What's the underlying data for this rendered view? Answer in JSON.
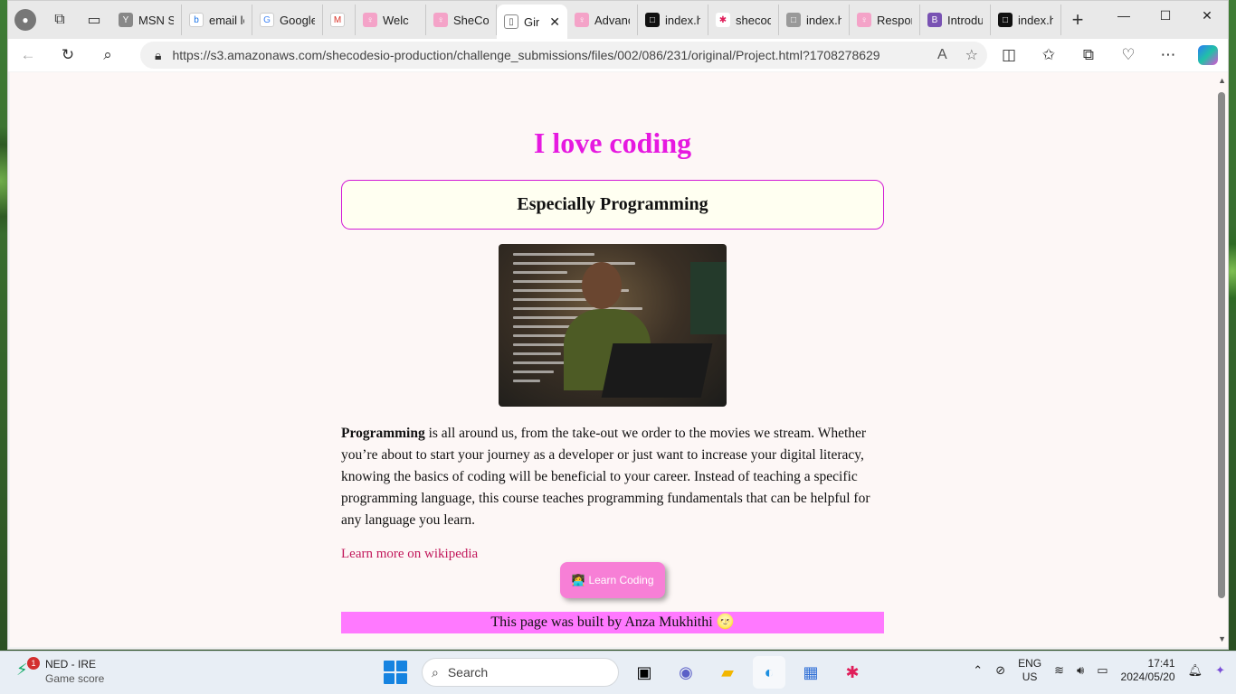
{
  "browser": {
    "tabs": [
      {
        "label": "",
        "icon": "workspaces-icon"
      },
      {
        "label": "MSN Sc",
        "icon": "msn-icon"
      },
      {
        "label": "email lo",
        "icon": "bing-icon"
      },
      {
        "label": "Google",
        "icon": "google-icon"
      },
      {
        "label": "",
        "icon": "gmail-icon"
      },
      {
        "label": "Welc",
        "icon": "shecodes-icon"
      },
      {
        "label": "SheCod",
        "icon": "shecodes-icon"
      },
      {
        "label": "Gir",
        "icon": "document-icon",
        "active": true
      },
      {
        "label": "Advance",
        "icon": "shecodes-icon"
      },
      {
        "label": "index.ht",
        "icon": "codesandbox-icon"
      },
      {
        "label": "shecode",
        "icon": "slack-icon"
      },
      {
        "label": "index.ht",
        "icon": "page-icon"
      },
      {
        "label": "Respons",
        "icon": "shecodes-icon"
      },
      {
        "label": "Introduc",
        "icon": "bootstrap-icon"
      },
      {
        "label": "index.ht",
        "icon": "codesandbox-icon"
      }
    ],
    "url": "https://s3.amazonaws.com/shecodesio-production/challenge_submissions/files/002/086/231/original/Project.html?1708278629"
  },
  "page": {
    "title": "I love coding",
    "subtitle": "Especially Programming",
    "paragraph_bold": "Programming",
    "paragraph_rest": " is all around us, from the take-out we order to the movies we stream. Whether you’re about to start your journey as a developer or just want to increase your digital literacy, knowing the basics of coding will be beneficial to your career. Instead of teaching a specific programming language, this course teaches programming fundamentals that can be helpful for any language you learn.",
    "link_text": "Learn more on wikipedia",
    "button_label": "Learn Coding",
    "button_emoji": "👩‍💻",
    "footer_text": "This page was built by Anza Mukhithi 🌝"
  },
  "taskbar": {
    "weather_title": "NED - IRE",
    "weather_sub": "Game score",
    "weather_badge": "1",
    "search_placeholder": "Search",
    "lang_top": "ENG",
    "lang_bottom": "US",
    "time": "17:41",
    "date": "2024/05/20"
  },
  "colors": {
    "heading": "#e619e0",
    "box_border": "#d21ad5",
    "box_bg": "#fffff1",
    "button_bg": "#f77fd6",
    "footer_bg": "#ff79ff",
    "link": "#c2185b",
    "page_bg": "#fdf7f6"
  }
}
